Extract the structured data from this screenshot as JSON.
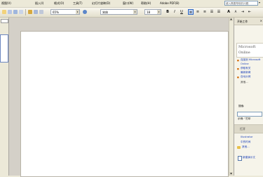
{
  "menu": {
    "items": [
      "视图(V)",
      "插入(I)",
      "格式(O)",
      "工具(T)",
      "幻灯片放映(D)",
      "窗口(W)",
      "帮助(H)",
      "Adobe PDF(B)"
    ],
    "help_placeholder": "键入需要帮助的问题"
  },
  "toolbar": {
    "zoom": "65%",
    "font_name": "宋体",
    "font_size": "18",
    "bold": "B",
    "italic": "I",
    "underline": "U"
  },
  "task_pane": {
    "title": "开始工作",
    "brand": [
      "Microsoft",
      "Online"
    ],
    "links": [
      "连接到 Microsoft",
      "Online",
      "获取有关",
      "最新新闻",
      "自动从网"
    ],
    "more": "其他...",
    "search_label": "搜索:",
    "example": "示例:   \"打印",
    "open_header": "打开",
    "recent_files": [
      "Illustrator",
      "中的时间"
    ],
    "more_files": "其他...",
    "new_presentation": "新建演示文"
  },
  "colors": {
    "menu_bg": "#ece9d8",
    "workspace_bg": "#d4d0c8",
    "link_blue": "#1a3fb8",
    "bullet_orange": "#d46800"
  }
}
